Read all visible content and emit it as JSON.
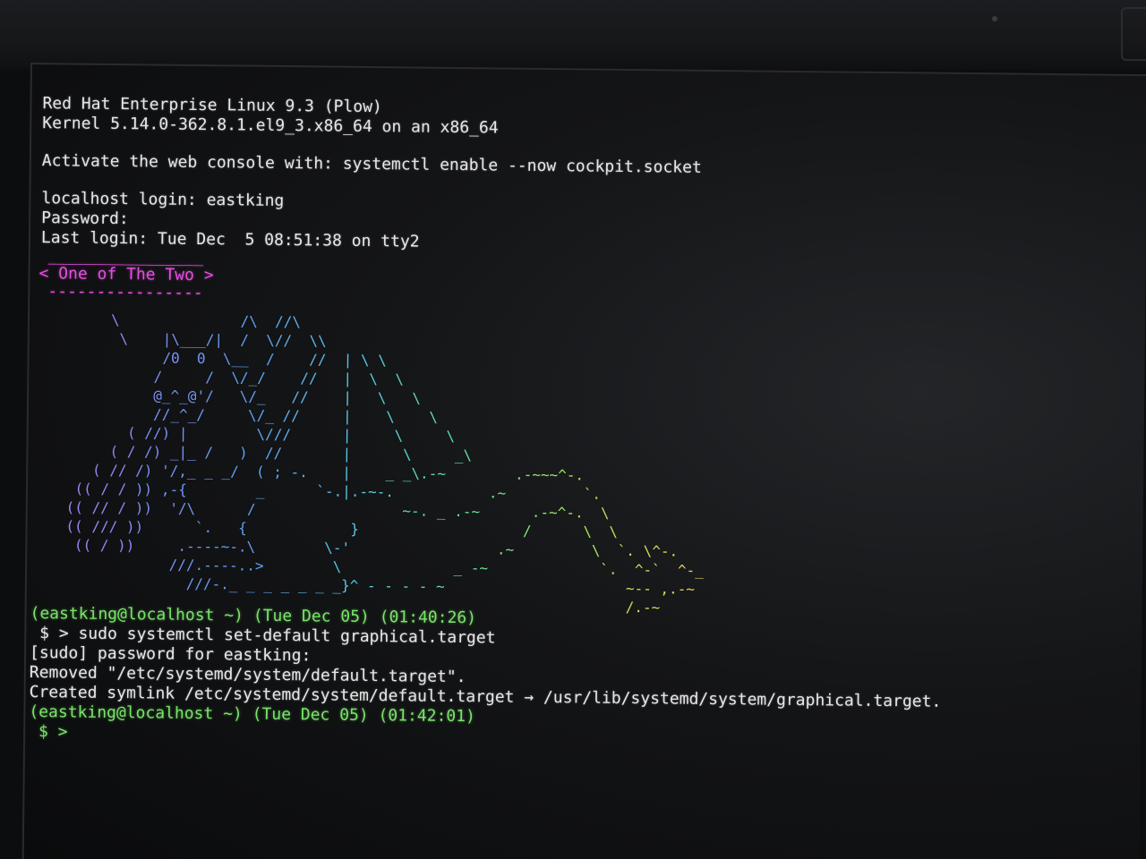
{
  "os_banner": {
    "release": "Red Hat Enterprise Linux 9.3 (Plow)",
    "kernel": "Kernel 5.14.0-362.8.1.el9_3.x86_64 on an x86_64"
  },
  "console_hint": "Activate the web console with: systemctl enable --now cockpit.socket",
  "login": {
    "login_line": "localhost login: eastking",
    "password_line": "Password:",
    "last_login": "Last login: Tue Dec  5 08:51:38 on tty2"
  },
  "banner": {
    "top_rule": "________________",
    "title": "< One of The Two >",
    "bottom_rule": "----------------"
  },
  "ascii_art": {
    "name": "dragon-ascii-art",
    "rows": [
      "        \\              /\\  //\\",
      "         \\    |\\___/|  /  \\//  \\\\",
      "              /0  0  \\__  /    //  | \\ \\",
      "             /     /  \\/_/    //   |  \\  \\",
      "             @_^_@'/   \\/_   //    |   \\   \\",
      "             //_^_/     \\/_ //     |    \\    \\",
      "          ( //) |        \\///      |     \\     \\",
      "        ( / /) _|_ /   )  //       |      \\     _\\",
      "      ( // /) '/,_ _ _/  ( ; -.    |    _ _\\.-~        .-~~~^-.",
      "    (( / / )) ,-{        _      `-.|.-~-.           .~         `.",
      "   (( // / ))  '/\\      /                 ~-. _ .-~      .-~^-.  \\",
      "   (( /// ))      `.   {            }                   /      \\  \\",
      "    (( / ))     .----~-.\\        \\-'                 .~         \\  `. \\^-.",
      "               ///.----..>        \\             _ -~             `.  ^-`  ^-_",
      "                 ///-._ _ _ _ _ _ _}^ - - - - ~                     ~-- ,.-~",
      "                                                                    /.-~"
    ],
    "colors": [
      "#b57cf2",
      "#7f8cf5",
      "#5fa0f0",
      "#58c8e8",
      "#5fe0a8",
      "#9ee860",
      "#e6d95a",
      "#f0a040"
    ]
  },
  "session": {
    "prompt1": "(eastking@localhost ~) (Tue Dec 05) (01:40:26)",
    "cmd1": " $ > sudo systemctl set-default graphical.target",
    "sudo_prompt": "[sudo] password for eastking:",
    "removed": "Removed \"/etc/systemd/system/default.target\".",
    "created": "Created symlink /etc/systemd/system/default.target → /usr/lib/systemd/system/graphical.target.",
    "prompt2": "(eastking@localhost ~) (Tue Dec 05) (01:42:01)",
    "cursor_prompt": " $ >"
  }
}
